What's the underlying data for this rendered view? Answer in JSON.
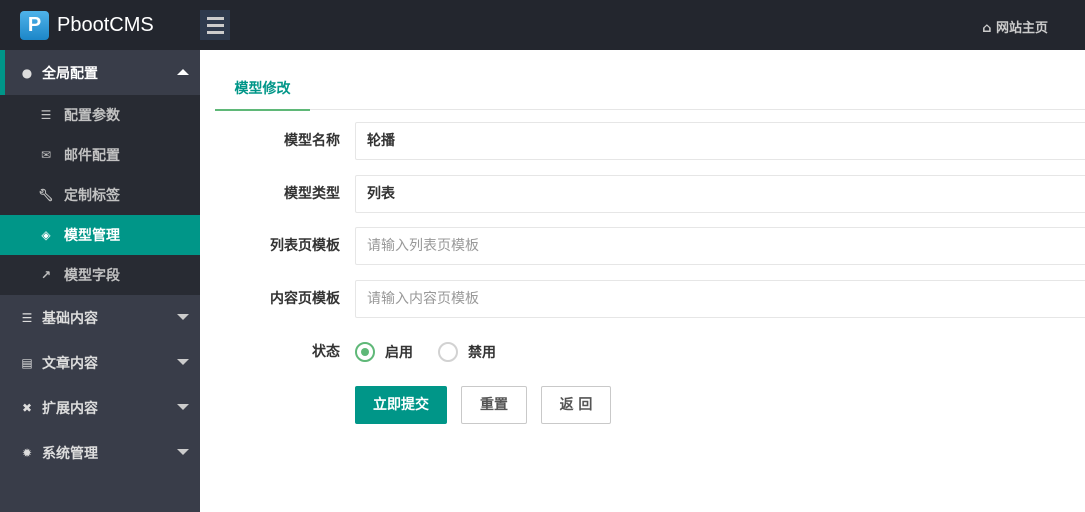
{
  "header": {
    "logo_mark": "P",
    "brand": "PbootCMS",
    "home_label": "网站主页",
    "home_icon": "home-icon"
  },
  "sidebar": {
    "groups": [
      {
        "label": "全局配置",
        "icon": "globe-icon",
        "expanded": true,
        "items": [
          {
            "label": "配置参数",
            "icon": "sliders-icon"
          },
          {
            "label": "邮件配置",
            "icon": "envelope-icon"
          },
          {
            "label": "定制标签",
            "icon": "wrench-icon"
          },
          {
            "label": "模型管理",
            "icon": "codepen-icon",
            "active": true
          },
          {
            "label": "模型字段",
            "icon": "external-link-icon"
          }
        ]
      },
      {
        "label": "基础内容",
        "icon": "sliders-icon"
      },
      {
        "label": "文章内容",
        "icon": "file-text-icon"
      },
      {
        "label": "扩展内容",
        "icon": "expand-icon"
      },
      {
        "label": "系统管理",
        "icon": "gear-icon"
      }
    ]
  },
  "main": {
    "tab": "模型修改",
    "form": {
      "name": {
        "label": "模型名称",
        "value": "轮播"
      },
      "type": {
        "label": "模型类型",
        "value": "列表"
      },
      "list_tpl": {
        "label": "列表页模板",
        "placeholder": "请输入列表页模板"
      },
      "content_tpl": {
        "label": "内容页模板",
        "placeholder": "请输入内容页模板"
      },
      "status": {
        "label": "状态",
        "options": [
          "启用",
          "禁用"
        ],
        "selected": "启用"
      }
    },
    "buttons": {
      "submit": "立即提交",
      "reset": "重置",
      "back": "返 回"
    }
  },
  "colors": {
    "accent": "#009688",
    "tab_underline": "#5FB878",
    "header_bg": "#23262E",
    "sidebar_bg": "#393D49"
  }
}
